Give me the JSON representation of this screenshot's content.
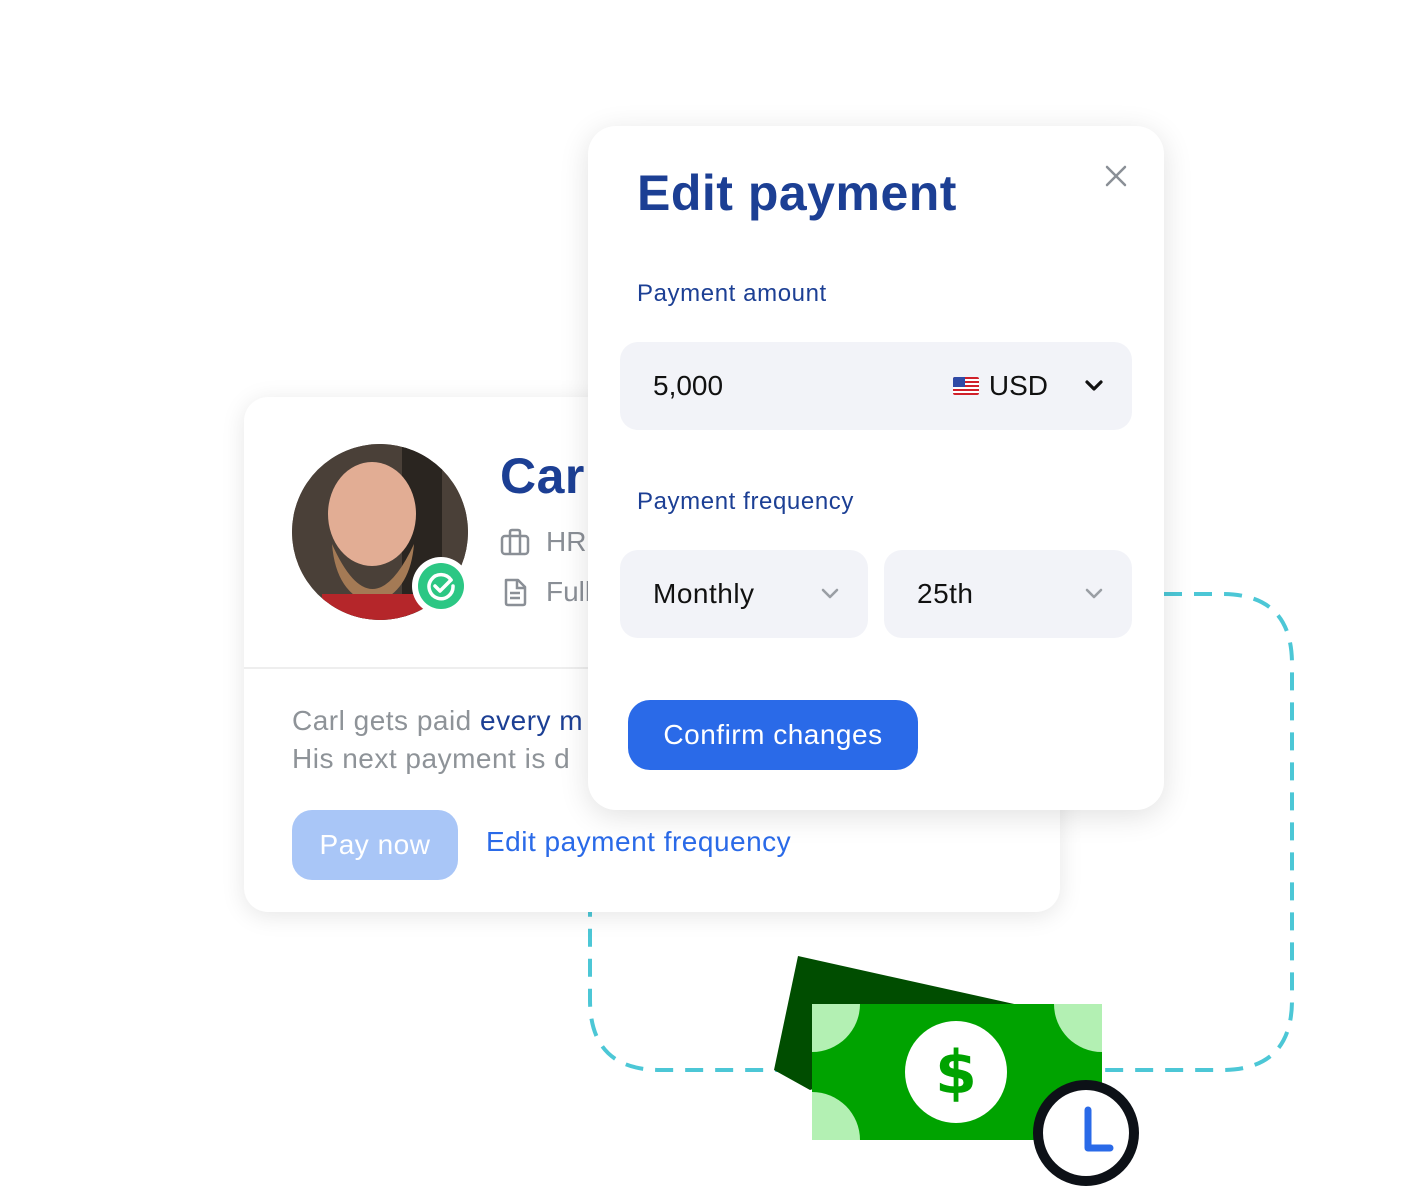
{
  "employee_card": {
    "name": "Carl",
    "department": "HR",
    "contract": "Full",
    "description_line1_prefix": "Carl gets paid ",
    "description_line1_highlight": "every m",
    "description_line2": "His next payment is d",
    "pay_now_label": "Pay now",
    "edit_frequency_label": "Edit payment frequency",
    "verified": true
  },
  "modal": {
    "title": "Edit payment",
    "close_icon": "close-icon",
    "payment_amount_label": "Payment amount",
    "payment_amount_value": "5,000",
    "currency": {
      "flag": "us-flag",
      "code": "USD"
    },
    "payment_frequency_label": "Payment frequency",
    "frequency_selected": "Monthly",
    "day_selected": "25th",
    "confirm_label": "Confirm changes"
  },
  "illustration": {
    "money_icon": "dollar-bill-icon",
    "clock_icon": "clock-icon"
  },
  "colors": {
    "brand_dark": "#1c3f94",
    "primary": "#2a6ae8",
    "primary_disabled": "#a9c6f7",
    "verified_green": "#2cc784",
    "connector": "#4cc7d6",
    "bill_green": "#00a300",
    "bill_dark": "#004d00",
    "bill_light": "#b3f0b3"
  }
}
